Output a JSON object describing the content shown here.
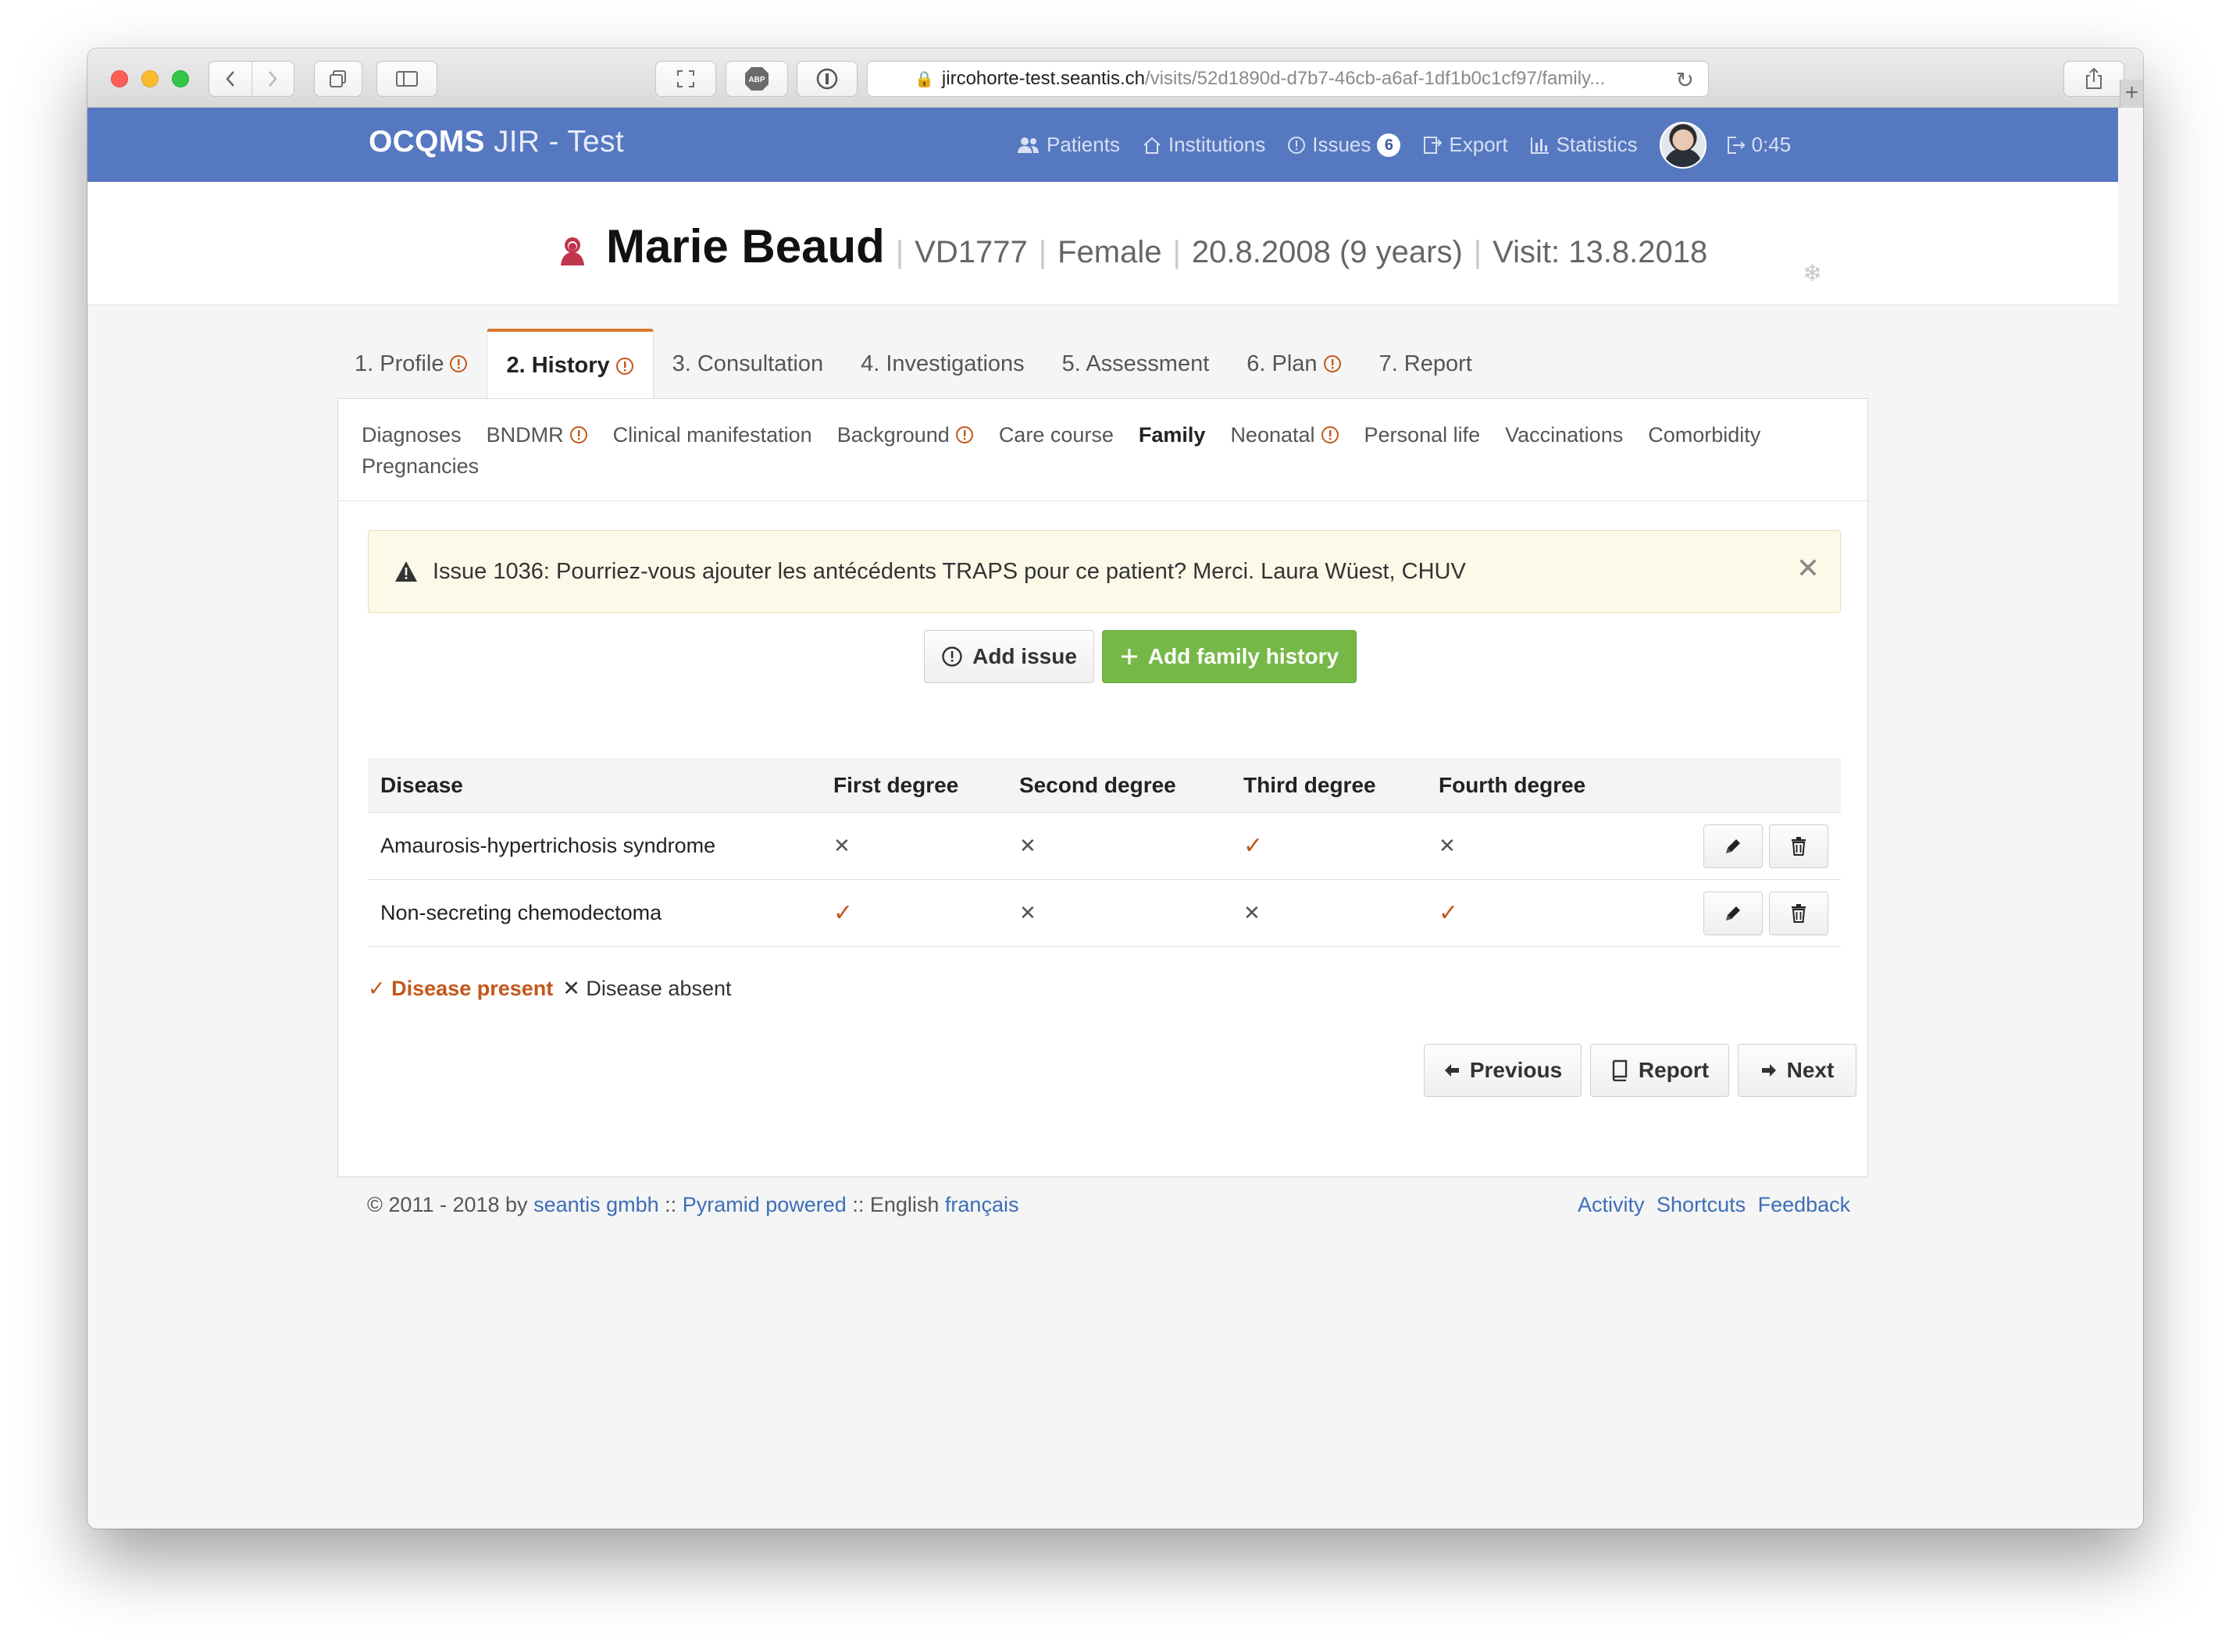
{
  "browser": {
    "url_host": "jircohorte-test.seantis.ch",
    "url_path": "/visits/52d1890d-d7b7-46cb-a6af-1df1b0c1cf97/family..."
  },
  "app": {
    "brand_bold": "OCQMS",
    "brand_rest": "JIR - Test",
    "nav": {
      "patients": "Patients",
      "institutions": "Institutions",
      "issues": "Issues",
      "issues_count": "6",
      "export": "Export",
      "statistics": "Statistics",
      "session_timer": "0:45"
    }
  },
  "patient": {
    "name": "Marie Beaud",
    "id": "VD1777",
    "sex": "Female",
    "birth": "20.8.2008 (9 years)",
    "visit": "Visit: 13.8.2018"
  },
  "tabs": [
    {
      "label": "1. Profile"
    },
    {
      "label": "2. History"
    },
    {
      "label": "3. Consultation"
    },
    {
      "label": "4. Investigations"
    },
    {
      "label": "5. Assessment"
    },
    {
      "label": "6. Plan"
    },
    {
      "label": "7. Report"
    }
  ],
  "subtabs": [
    {
      "label": "Diagnoses"
    },
    {
      "label": "BNDMR"
    },
    {
      "label": "Clinical manifestation"
    },
    {
      "label": "Background"
    },
    {
      "label": "Care course"
    },
    {
      "label": "Family"
    },
    {
      "label": "Neonatal"
    },
    {
      "label": "Personal life"
    },
    {
      "label": "Vaccinations"
    },
    {
      "label": "Comorbidity"
    },
    {
      "label": "Pregnancies"
    }
  ],
  "alert": {
    "message": "Issue 1036: Pourriez-vous ajouter les antécédents TRAPS pour ce patient? Merci. Laura Wüest, CHUV",
    "close": "✕"
  },
  "actions": {
    "add_issue": "Add issue",
    "add_family_history": "Add family history"
  },
  "table": {
    "headers": [
      "Disease",
      "First degree",
      "Second degree",
      "Third degree",
      "Fourth degree"
    ],
    "rows": [
      {
        "disease": "Amaurosis-hypertrichosis syndrome",
        "first": "✕",
        "second": "✕",
        "third": "✓",
        "fourth": "✕"
      },
      {
        "disease": "Non-secreting chemodectoma",
        "first": "✓",
        "second": "✕",
        "third": "✕",
        "fourth": "✓"
      }
    ]
  },
  "legend": {
    "present": "✓ Disease present",
    "absent": "✕ Disease absent"
  },
  "pager": {
    "previous": "Previous",
    "report": "Report",
    "next": "Next"
  },
  "footer": {
    "copyright": "© 2011 - 2018 by",
    "company": "seantis gmbh",
    "sep1": "::",
    "pyramid": "Pyramid powered",
    "sep2": "::",
    "lang_current": "English",
    "lang_other": "français",
    "activity": "Activity",
    "shortcuts": "Shortcuts",
    "feedback": "Feedback"
  },
  "colors": {
    "navbar": "#5678c0",
    "accent_tab": "#d9782d",
    "present_mark": "#c2571a",
    "success_button": "#76b847",
    "link": "#3c6db8"
  }
}
